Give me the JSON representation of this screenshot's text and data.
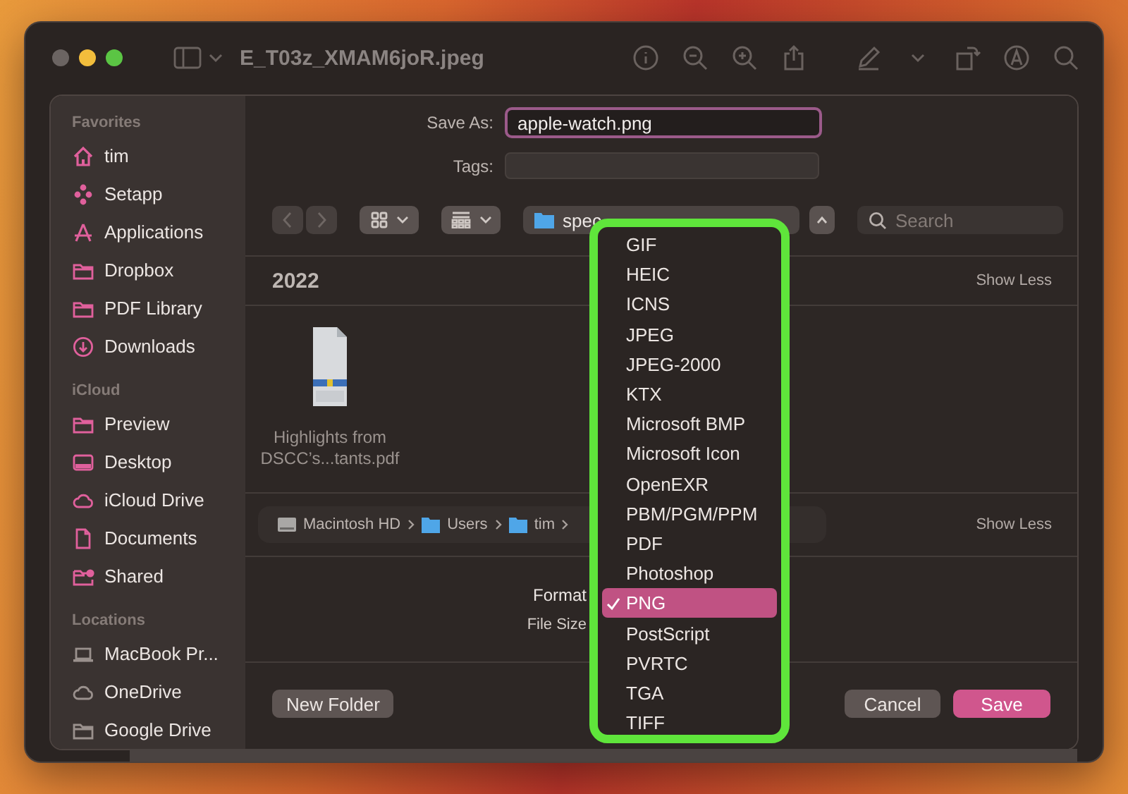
{
  "window": {
    "title": "E_T03z_XMAM6joR.jpeg"
  },
  "sidebar": {
    "sections": [
      {
        "heading": "Favorites",
        "items": [
          {
            "label": "tim"
          },
          {
            "label": "Setapp"
          },
          {
            "label": "Applications"
          },
          {
            "label": "Dropbox"
          },
          {
            "label": "PDF Library"
          },
          {
            "label": "Downloads"
          }
        ]
      },
      {
        "heading": "iCloud",
        "items": [
          {
            "label": "Preview"
          },
          {
            "label": "Desktop"
          },
          {
            "label": "iCloud Drive"
          },
          {
            "label": "Documents"
          },
          {
            "label": "Shared"
          }
        ]
      },
      {
        "heading": "Locations",
        "items": [
          {
            "label": "MacBook Pr..."
          },
          {
            "label": "OneDrive"
          },
          {
            "label": "Google Drive"
          }
        ]
      }
    ]
  },
  "save_as": {
    "label": "Save As:",
    "value": "apple-watch.png"
  },
  "tags": {
    "label": "Tags:"
  },
  "location": {
    "folder": "spec"
  },
  "search": {
    "placeholder": "Search"
  },
  "sections": [
    {
      "title": "2022",
      "action": "Show Less",
      "files": [
        {
          "name": "Highlights from DSCC’s...tants.pdf"
        }
      ]
    },
    {
      "action": "Show Less",
      "path": [
        "Macintosh HD",
        "Users",
        "tim"
      ]
    }
  ],
  "options": {
    "format_label": "Format",
    "file_size_label": "File Size"
  },
  "format_menu": [
    {
      "label": "GIF",
      "selected": false
    },
    {
      "label": "HEIC",
      "selected": false
    },
    {
      "label": "ICNS",
      "selected": false
    },
    {
      "label": "JPEG",
      "selected": false
    },
    {
      "label": "JPEG-2000",
      "selected": false
    },
    {
      "label": "KTX",
      "selected": false
    },
    {
      "label": "Microsoft BMP",
      "selected": false
    },
    {
      "label": "Microsoft Icon",
      "selected": false
    },
    {
      "label": "OpenEXR",
      "selected": false
    },
    {
      "label": "PBM/PGM/PPM",
      "selected": false
    },
    {
      "label": "PDF",
      "selected": false
    },
    {
      "label": "Photoshop",
      "selected": false
    },
    {
      "label": "PNG",
      "selected": true
    },
    {
      "label": "PostScript",
      "selected": false
    },
    {
      "label": "PVRTC",
      "selected": false
    },
    {
      "label": "TGA",
      "selected": false
    },
    {
      "label": "TIFF",
      "selected": false
    }
  ],
  "buttons": {
    "new_folder": "New Folder",
    "cancel": "Cancel",
    "save": "Save"
  }
}
